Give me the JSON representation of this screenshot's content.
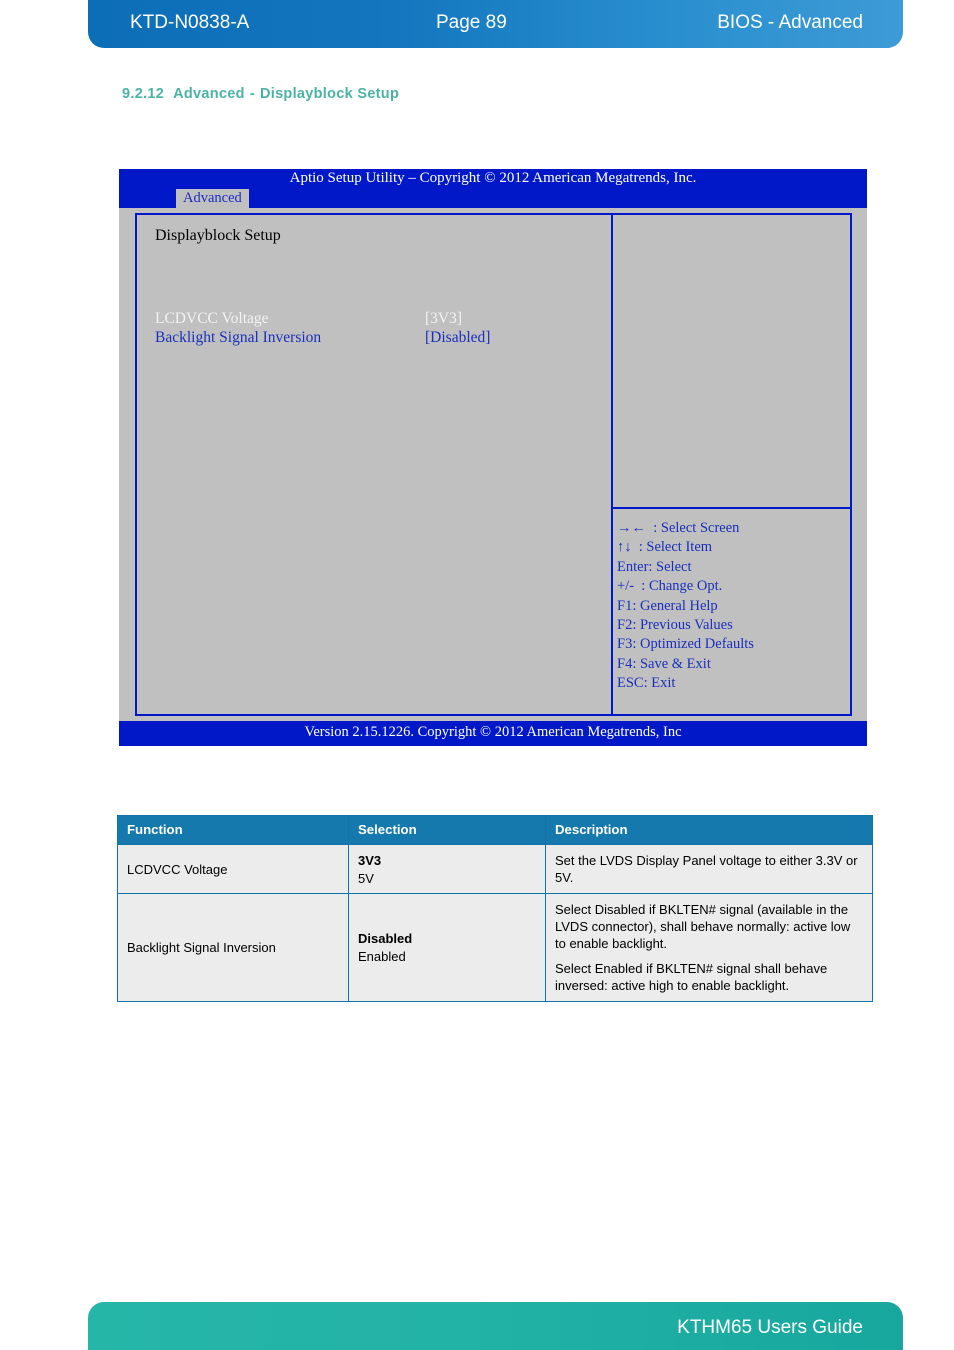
{
  "header": {
    "doc_id": "KTD-N0838-A",
    "page_label": "Page 89",
    "section_name": "BIOS - Advanced"
  },
  "section": {
    "number": "9.2.12",
    "title": "Advanced",
    "dash": "-",
    "subtitle": "Displayblock Setup"
  },
  "bios": {
    "title": "Aptio Setup Utility  –  Copyright © 2012 American Megatrends, Inc.",
    "active_tab": "Advanced",
    "panel_heading": "Displayblock Setup",
    "settings": [
      {
        "label": "LCDVCC Voltage",
        "value": "[3V3]"
      },
      {
        "label": "Backlight Signal Inversion",
        "value": "[Disabled]"
      }
    ],
    "help_keys": [
      "→←  : Select Screen",
      "↑↓  : Select Item",
      "Enter: Select",
      "+/-  : Change Opt.",
      "F1: General Help",
      "F2: Previous Values",
      "F3: Optimized Defaults",
      "F4: Save & Exit",
      "ESC: Exit"
    ],
    "footer": "Version 2.15.1226. Copyright © 2012 American Megatrends, Inc"
  },
  "table": {
    "headers": {
      "function": "Function",
      "selection": "Selection",
      "description": "Description"
    },
    "rows": [
      {
        "function": "LCDVCC Voltage",
        "selection_default": "3V3",
        "selection_alt": "5V",
        "description_1": "Set the LVDS Display Panel voltage to either 3.3V or 5V.",
        "description_2": ""
      },
      {
        "function": "Backlight Signal Inversion",
        "selection_default": "Disabled",
        "selection_alt": "Enabled",
        "description_1": "Select Disabled if BKLTEN# signal (available in the LVDS connector), shall behave normally: active low to enable backlight.",
        "description_2": "Select Enabled if BKLTEN# signal shall behave inversed: active high to enable backlight."
      }
    ]
  },
  "footer": {
    "guide_title": "KTHM65 Users Guide"
  },
  "colors": {
    "header_blue": "#0d6eb8",
    "footer_teal": "#26b6a8",
    "heading_teal": "#4bb3a2",
    "bios_blue": "#0018c8",
    "bios_gray": "#c0c0c0",
    "table_header": "#1579ae"
  }
}
